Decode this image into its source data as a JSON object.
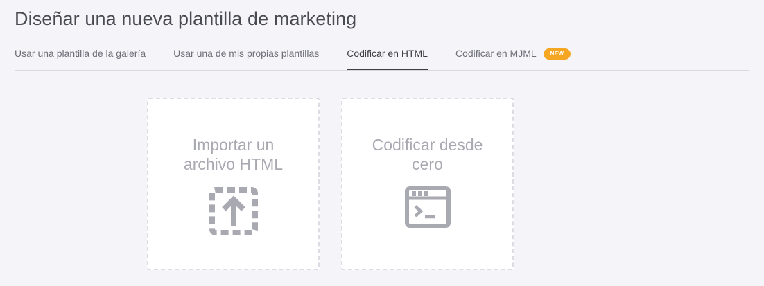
{
  "header": {
    "title": "Diseñar una nueva plantilla de marketing"
  },
  "tabs": [
    {
      "label": "Usar una plantilla de la galería",
      "active": false
    },
    {
      "label": "Usar una de mis propias plantillas",
      "active": false
    },
    {
      "label": "Codificar en HTML",
      "active": true
    },
    {
      "label": "Codificar en MJML",
      "active": false,
      "badge": "NEW"
    }
  ],
  "cards": [
    {
      "line1": "Importar un",
      "line2": "archivo HTML",
      "icon": "upload-dashed-icon"
    },
    {
      "line1": "Codificar desde",
      "line2": "cero",
      "icon": "terminal-window-icon"
    }
  ],
  "colors": {
    "background": "#f5f5f9",
    "badge": "#f5a623",
    "icon": "#a9a9b2",
    "active_tab": "#3d3d45"
  }
}
